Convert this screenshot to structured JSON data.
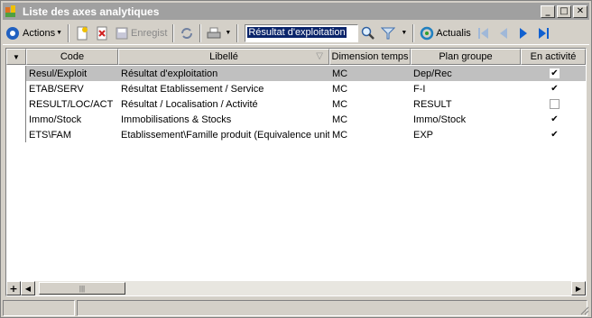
{
  "window": {
    "title": "Liste des axes analytiques",
    "controls": [
      "_",
      "□",
      "✕"
    ]
  },
  "toolbar": {
    "actions_label": "Actions",
    "save_label": "Enregist",
    "search_value": "Résultat d'exploitation",
    "refresh_label": "Actualis"
  },
  "grid": {
    "columns": [
      "Code",
      "Libellé",
      "Dimension temps",
      "Plan groupe",
      "En activité"
    ],
    "rows": [
      {
        "code": "Resul/Exploit",
        "libelle": "Résultat d'exploitation",
        "dimension": "MC",
        "plan": "Dep/Rec",
        "active": true,
        "selected": true
      },
      {
        "code": "ETAB/SERV",
        "libelle": "Résultat Etablissement / Service",
        "dimension": "MC",
        "plan": "F-I",
        "active": true,
        "selected": false
      },
      {
        "code": "RESULT/LOC/ACT",
        "libelle": "Résultat / Localisation / Activité",
        "dimension": "MC",
        "plan": "RESULT",
        "active": false,
        "selected": false
      },
      {
        "code": "Immo/Stock",
        "libelle": "Immobilisations & Stocks",
        "dimension": "MC",
        "plan": "Immo/Stock",
        "active": true,
        "selected": false
      },
      {
        "code": "ETS\\FAM",
        "libelle": "Etablissement\\Famille produit (Equivalence unit",
        "dimension": "MC",
        "plan": "EXP",
        "active": true,
        "selected": false
      }
    ]
  },
  "scrollbar": {
    "plus_label": "+"
  },
  "colors": {
    "titlebar": "#a0a0a0",
    "selection": "#c0c0c0",
    "nav_blue": "#1060d0"
  }
}
